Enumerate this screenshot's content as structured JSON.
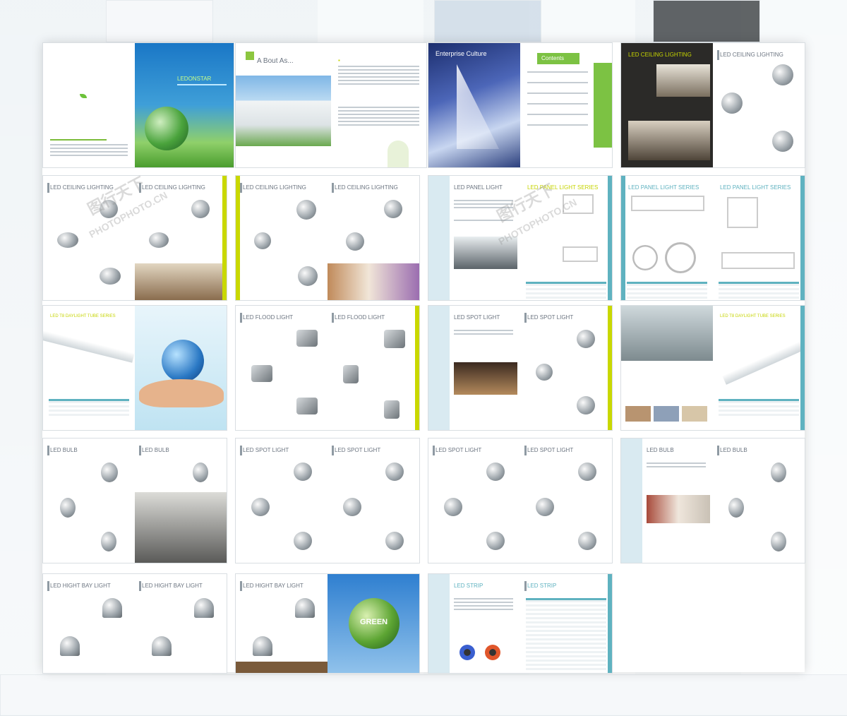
{
  "brochure": {
    "cover_title": "LEDONSTAR",
    "about_title": "A Bout As...",
    "enterprise_title": "Enterprise Culture",
    "contents_title": "Contents",
    "green_label": "GREEN",
    "watermark_cn": "图行天下",
    "watermark_url": "PHOTOPHOTO.CN"
  },
  "sections": {
    "ceiling": "LED CEILING LIGHTING",
    "panel": "LED PANEL LIGHT",
    "panel_series": "LED  PANEL LIGHT SERIES",
    "flood": "LED FLOOD LIGHT",
    "spot": "LED SPOT LIGHT",
    "tube": "LED T8 DAYLIGHT TUBE SERIES",
    "bulb": "LED BULB",
    "highbay": "LED HIGHT BAY LIGHT",
    "strip": "LED STRIP"
  }
}
